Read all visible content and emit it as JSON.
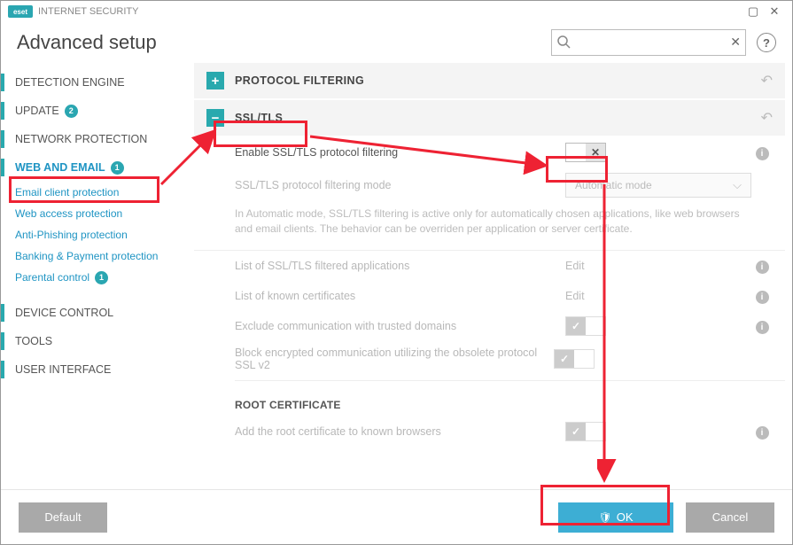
{
  "title_brand": "eset",
  "title_prod": "INTERNET SECURITY",
  "page_title": "Advanced setup",
  "search": {
    "placeholder": ""
  },
  "side": {
    "detection": "DETECTION ENGINE",
    "update": "UPDATE",
    "update_badge": "2",
    "network": "NETWORK PROTECTION",
    "web": "WEB AND EMAIL",
    "web_badge": "1",
    "sub_email": "Email client protection",
    "sub_web": "Web access protection",
    "sub_phish": "Anti-Phishing protection",
    "sub_bank": "Banking & Payment protection",
    "sub_parent": "Parental control",
    "parent_badge": "1",
    "device": "DEVICE CONTROL",
    "tools": "TOOLS",
    "ui": "USER INTERFACE"
  },
  "sect_proto": "PROTOCOL FILTERING",
  "sect_ssl": "SSL/TLS",
  "r_enable": "Enable SSL/TLS protocol filtering",
  "r_mode": "SSL/TLS protocol filtering mode",
  "r_mode_val": "Automatic mode",
  "desc": "In Automatic mode, SSL/TLS filtering is active only for automatically chosen applications, like web browsers and email clients. The behavior can be overriden per application or server certificate.",
  "r_apps": "List of SSL/TLS filtered applications",
  "r_certs": "List of known certificates",
  "edit": "Edit",
  "r_trusted": "Exclude communication with trusted domains",
  "r_sslv2": "Block encrypted communication utilizing the obsolete protocol SSL v2",
  "subh_root": "ROOT CERTIFICATE",
  "r_root": "Add the root certificate to known browsers",
  "btn_default": "Default",
  "btn_ok": "OK",
  "btn_cancel": "Cancel"
}
